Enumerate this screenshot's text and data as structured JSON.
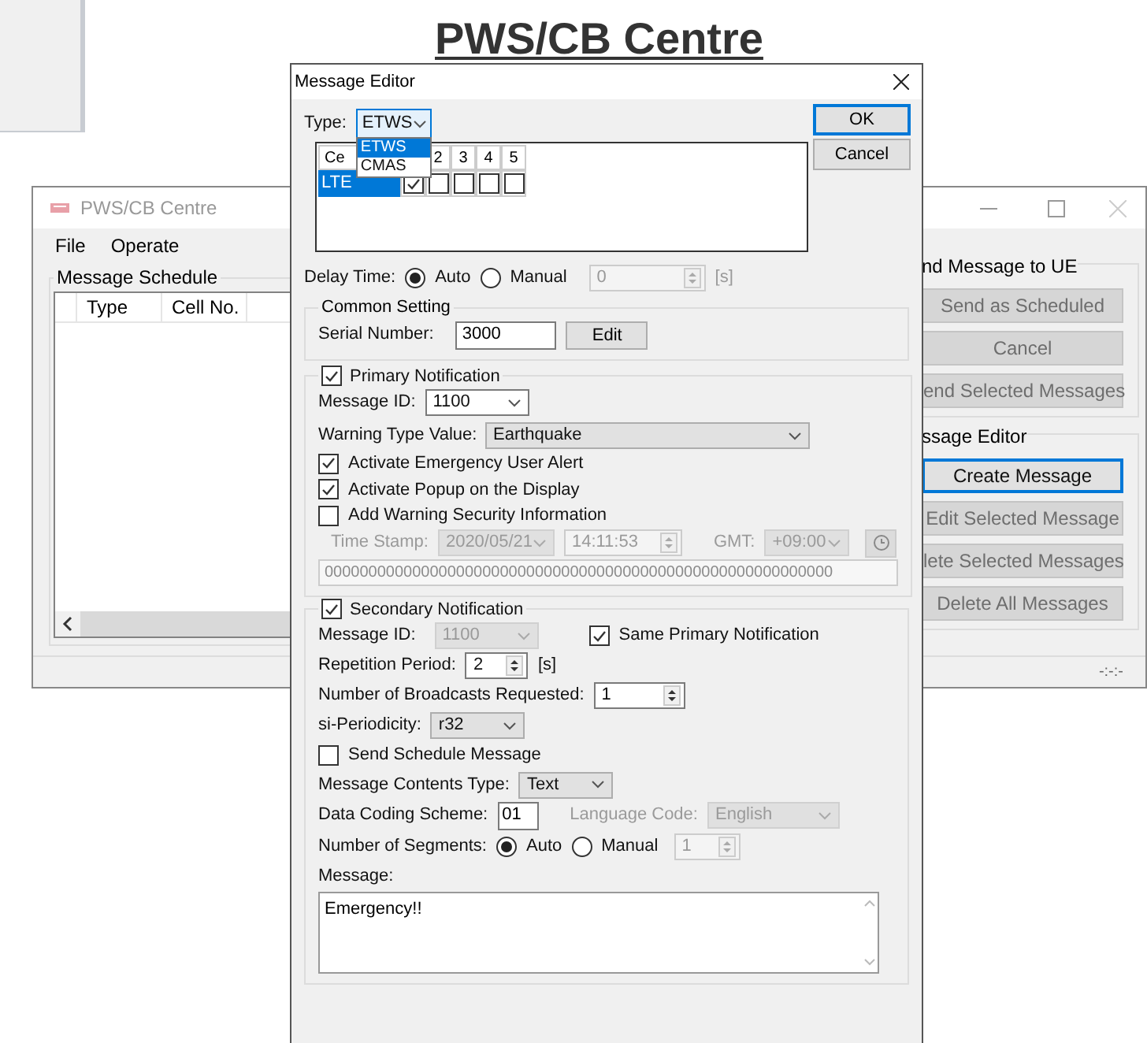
{
  "page_title": "PWS/CB Centre",
  "main_window": {
    "title": "PWS/CB Centre",
    "menu": [
      "File",
      "Operate"
    ],
    "schedule": {
      "title": "Message Schedule",
      "columns": [
        "Type",
        "Cell No."
      ]
    },
    "send_group": {
      "title": "nd Message to UE",
      "buttons": [
        {
          "label": "Send as Scheduled",
          "disabled": true
        },
        {
          "label": "Cancel",
          "disabled": true
        },
        {
          "label": "end Selected Messages",
          "disabled": true
        }
      ]
    },
    "editor_group": {
      "title": "ssage Editor",
      "buttons": [
        {
          "label": "Create Message",
          "disabled": false
        },
        {
          "label": "Edit Selected Message",
          "disabled": true
        },
        {
          "label": "lete Selected Messages",
          "disabled": true
        },
        {
          "label": "Delete All Messages",
          "disabled": true
        }
      ]
    },
    "status": "-:-:-"
  },
  "dialog": {
    "title": "Message Editor",
    "buttons": [
      "OK",
      "Cancel"
    ],
    "type": {
      "label": "Type:",
      "value": "ETWS",
      "options": [
        {
          "label": "ETWS",
          "selected": true
        },
        {
          "label": "CMAS",
          "selected": false
        }
      ]
    },
    "cell_grid": {
      "columns": [
        "Ce",
        "2",
        "3",
        "4",
        "5"
      ],
      "rows": [
        {
          "label": "LTE",
          "selected": true,
          "cells": [
            {
              "checked": true
            },
            {
              "checked": false
            },
            {
              "checked": false
            },
            {
              "checked": false
            },
            {
              "checked": false
            }
          ]
        }
      ]
    },
    "delay": {
      "label": "Delay Time:",
      "options": [
        {
          "label": "Auto",
          "selected": true
        },
        {
          "label": "Manual",
          "selected": false
        }
      ],
      "value": "0",
      "unit": "[s]"
    },
    "common": {
      "title": "Common Setting",
      "serial_label": "Serial Number:",
      "serial_value": "3000",
      "edit_button": "Edit"
    },
    "primary": {
      "title": "Primary Notification",
      "checked": true,
      "message_id_label": "Message ID:",
      "message_id": "1100",
      "warning_type_label": "Warning Type Value:",
      "warning_type": "Earthquake",
      "options": [
        {
          "label": "Activate Emergency User Alert",
          "checked": true
        },
        {
          "label": "Activate Popup on the Display",
          "checked": true
        },
        {
          "label": "Add Warning Security Information",
          "checked": false
        }
      ],
      "timestamp": {
        "label": "Time Stamp:",
        "date": "2020/05/21",
        "time": "14:11:53",
        "gmt_label": "GMT:",
        "gmt": "+09:00",
        "disabled": true
      },
      "security_info": "0000000000000000000000000000000000000000000000000000000000"
    },
    "secondary": {
      "title": "Secondary Notification",
      "checked": true,
      "message_id_label": "Message ID:",
      "message_id": "1100",
      "message_id_disabled": true,
      "same_primary": {
        "label": "Same Primary Notification",
        "checked": true
      },
      "repetition_label": "Repetition Period:",
      "repetition": "2",
      "repetition_unit": "[s]",
      "broadcasts_label": "Number of Broadcasts Requested:",
      "broadcasts": "1",
      "si_label": "si-Periodicity:",
      "si": "r32",
      "send_schedule": {
        "label": "Send Schedule Message",
        "checked": false
      },
      "contents_type_label": "Message Contents Type:",
      "contents_type": "Text",
      "dcs_label": "Data Coding Scheme:",
      "dcs": "01",
      "language": {
        "label": "Language Code:",
        "value": "English",
        "disabled": true
      },
      "segments": {
        "label": "Number of Segments:",
        "options": [
          {
            "label": "Auto",
            "selected": true
          },
          {
            "label": "Manual",
            "selected": false
          }
        ],
        "value": "1"
      },
      "message_label": "Message:",
      "message": "Emergency!!"
    }
  }
}
